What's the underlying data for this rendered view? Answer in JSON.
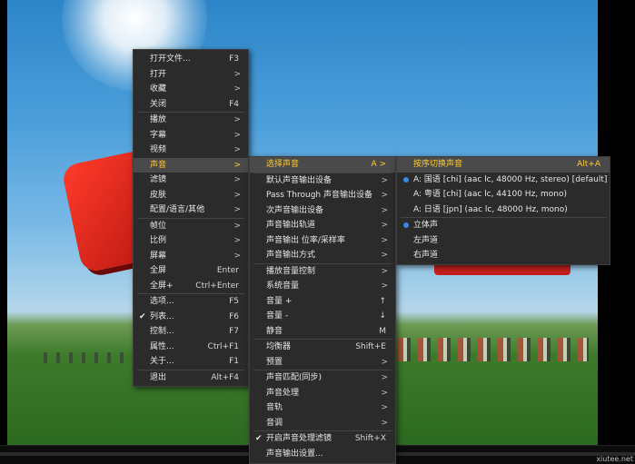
{
  "main_menu": [
    {
      "label": "打开文件...",
      "shortcut": "F3"
    },
    {
      "label": "打开",
      "arrow": ">"
    },
    {
      "label": "收藏",
      "arrow": ">"
    },
    {
      "label": "关闭",
      "shortcut": "F4"
    },
    {
      "label": "播放",
      "arrow": ">"
    },
    {
      "label": "字幕",
      "arrow": ">"
    },
    {
      "label": "视频",
      "arrow": ">"
    },
    {
      "label": "声音",
      "arrow": ">"
    },
    {
      "label": "滤镜",
      "arrow": ">"
    },
    {
      "label": "皮肤",
      "arrow": ">"
    },
    {
      "label": "配置/语言/其他",
      "arrow": ">"
    },
    {
      "label": "帧位",
      "arrow": ">"
    },
    {
      "label": "比例",
      "arrow": ">"
    },
    {
      "label": "屏幕",
      "arrow": ">"
    },
    {
      "label": "全屏",
      "shortcut": "Enter"
    },
    {
      "label": "全屏+",
      "shortcut": "Ctrl+Enter"
    },
    {
      "label": "选项...",
      "shortcut": "F5"
    },
    {
      "label": "列表...",
      "shortcut": "F6"
    },
    {
      "label": "控制...",
      "shortcut": "F7"
    },
    {
      "label": "属性...",
      "shortcut": "Ctrl+F1"
    },
    {
      "label": "关于...",
      "shortcut": "F1"
    },
    {
      "label": "退出",
      "shortcut": "Alt+F4"
    }
  ],
  "audio_menu": [
    {
      "label": "选择声音",
      "shortcut": "A >"
    },
    {
      "label": "默认声音输出设备",
      "arrow": ">"
    },
    {
      "label": "Pass Through 声音输出设备",
      "arrow": ">"
    },
    {
      "label": "次声音输出设备",
      "arrow": ">"
    },
    {
      "label": "声音输出轨道",
      "arrow": ">"
    },
    {
      "label": "声音输出 位率/采样率",
      "arrow": ">"
    },
    {
      "label": "声音输出方式",
      "arrow": ">"
    },
    {
      "label": "播放音量控制",
      "arrow": ">"
    },
    {
      "label": "系统音量",
      "arrow": ">"
    },
    {
      "label": "音量 +",
      "shortcut": "↑"
    },
    {
      "label": "音量 -",
      "shortcut": "↓"
    },
    {
      "label": "静音",
      "shortcut": "M"
    },
    {
      "label": "均衡器",
      "shortcut": "Shift+E"
    },
    {
      "label": "预置",
      "arrow": ">"
    },
    {
      "label": "声音匹配(同步)",
      "arrow": ">"
    },
    {
      "label": "声音处理",
      "arrow": ">"
    },
    {
      "label": "音轨",
      "arrow": ">"
    },
    {
      "label": "音调",
      "arrow": ">"
    },
    {
      "label": "开启声音处理滤镜",
      "shortcut": "Shift+X"
    },
    {
      "label": "声音输出设置..."
    }
  ],
  "track_menu": [
    {
      "label": "按序切换声音",
      "shortcut": "Alt+A"
    },
    {
      "label": "A: 国语 [chi] (aac lc, 48000 Hz, stereo) [default]"
    },
    {
      "label": "A: 粤语 [chi] (aac lc, 44100 Hz, mono)"
    },
    {
      "label": "A: 日语 [jpn] (aac lc, 48000 Hz, mono)"
    },
    {
      "label": "立体声"
    },
    {
      "label": "左声道"
    },
    {
      "label": "右声道"
    }
  ],
  "watermark": "xiutee.net",
  "accent_color": "#ffcc33",
  "radio_color": "#2f8de4"
}
